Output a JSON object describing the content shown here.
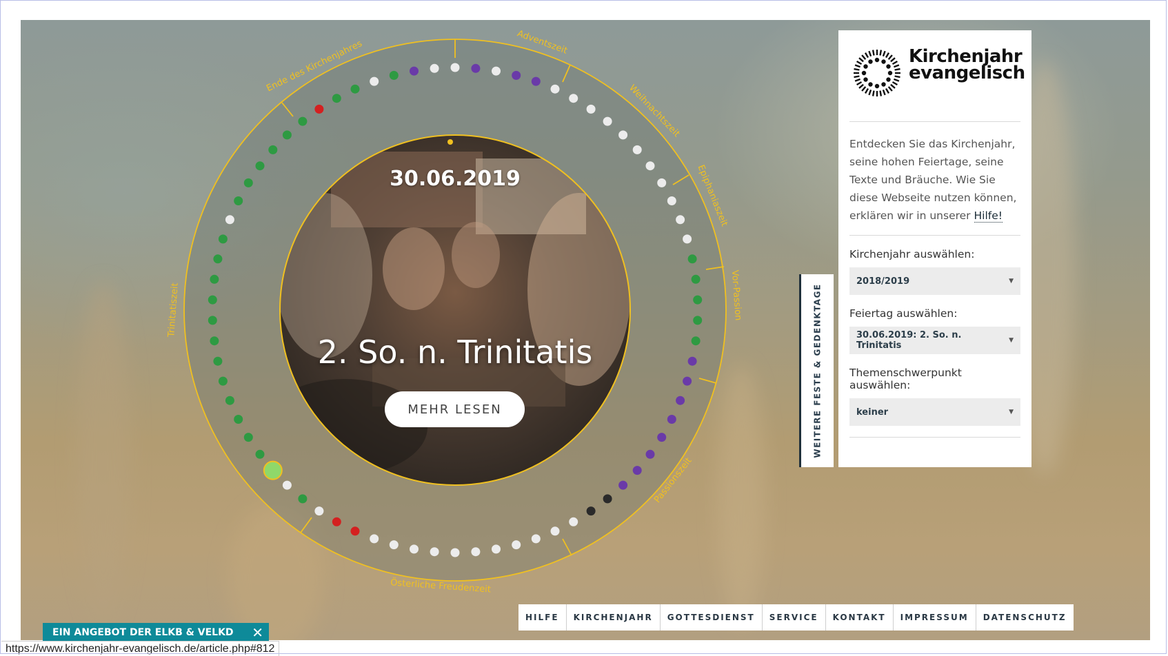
{
  "center": {
    "date": "30.06.2019",
    "title": "2. So. n. Trinitatis",
    "more_button": "MEHR LESEN"
  },
  "season_labels": [
    "Adventszeit",
    "Weihnachtszeit",
    "Epiphaniaszeit",
    "Vor-Passion",
    "Passionszeit",
    "Österliche Freudenzeit",
    "Trinitatiszeit",
    "Ende des Kirchenjahres"
  ],
  "side_tab": "WEITERE FESTE & GEDENKTAGE",
  "panel": {
    "logo_line1": "Kirchenjahr",
    "logo_line2": "evangelisch",
    "intro_text": "Entdecken Sie das Kirchenjahr, seine hohen Feiertage, seine Texte und Bräuche. Wie Sie diese Webseite nutzen können, erklären wir in unserer",
    "intro_link": "Hilfe!",
    "year_label": "Kirchenjahr auswählen:",
    "year_value": "2018/2019",
    "holiday_label": "Feiertag auswählen:",
    "holiday_value": "30.06.2019: 2. So. n. Trinitatis",
    "theme_label": "Themenschwerpunkt auswählen:",
    "theme_value": "keiner"
  },
  "footer_nav": [
    "HILFE",
    "KIRCHENJAHR",
    "GOTTESDIENST",
    "SERVICE",
    "KONTAKT",
    "IMPRESSUM",
    "DATENSCHUTZ"
  ],
  "offer_bar": "EIN ANGEBOT DER ELKB & VELKD",
  "status_url": "https://www.kirchenjahr-evangelisch.de/article.php#812",
  "colors": {
    "accent_gold": "#f0c020",
    "dot_white": "#ececec",
    "dot_green": "#2e9a42",
    "dot_purple": "#6a3aa8",
    "dot_red": "#d42020",
    "dot_black": "#2a2a2a",
    "dot_current": "#8fd86a",
    "offer_teal": "#0e8a99"
  },
  "icons": [
    "church-year-logo-icon",
    "caret-down-icon",
    "close-icon"
  ]
}
